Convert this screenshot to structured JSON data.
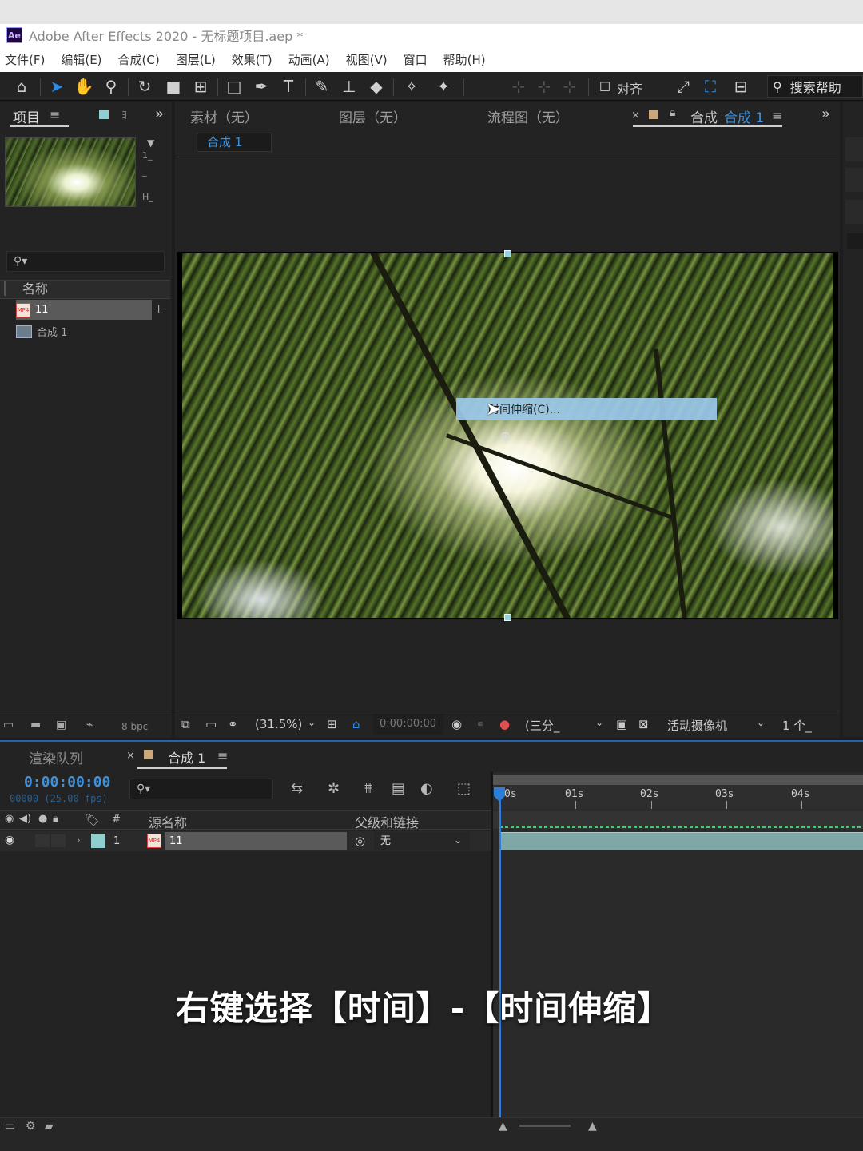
{
  "window": {
    "title": "Adobe After Effects 2020 - 无标题项目.aep *",
    "logo": "Ae"
  },
  "menu": [
    "文件(F)",
    "编辑(E)",
    "合成(C)",
    "图层(L)",
    "效果(T)",
    "动画(A)",
    "视图(V)",
    "窗口",
    "帮助(H)"
  ],
  "toolbar": {
    "align_label": "对齐",
    "search_help": "搜索帮助"
  },
  "project_panel": {
    "tab": "项目",
    "search_placeholder": "",
    "column_name": "名称",
    "thumb_info": [
      "1_",
      "_",
      "H_"
    ],
    "items": [
      {
        "name": "11",
        "icon": "video-file-icon"
      },
      {
        "name": "合成 1",
        "icon": "composition-icon"
      }
    ],
    "bpc": "8 bpc"
  },
  "comp_panel": {
    "tabs": [
      "素材（无）",
      "图层（无）",
      "流程图（无）"
    ],
    "active_tab_prefix": "合成",
    "active_tab_name": "合成 1",
    "breadcrumb": "合成 1",
    "context_item": "时间伸缩(C)...",
    "zoom": "(31.5%)",
    "timecode": "0:00:00:00",
    "resolution": "(三分_",
    "camera": "活动摄像机",
    "views": "1 个_"
  },
  "timeline": {
    "render_queue_tab": "渲染队列",
    "comp_tab": "合成 1",
    "timecode": "0:00:00:00",
    "fps": "00000 (25.00 fps)",
    "col_number": "#",
    "col_source": "源名称",
    "col_parent": "父级和链接",
    "layer": {
      "number": "1",
      "name": "11",
      "parent": "无"
    },
    "ruler": [
      "0s",
      "01s",
      "02s",
      "03s",
      "04s"
    ]
  },
  "subtitle": "右键选择【时间】-【时间伸缩】",
  "colors": {
    "accent_blue": "#2b7fd8",
    "timecode_blue": "#3c92dc",
    "label_teal": "#8fcfcf",
    "clip_bar": "#7ea8a8"
  }
}
